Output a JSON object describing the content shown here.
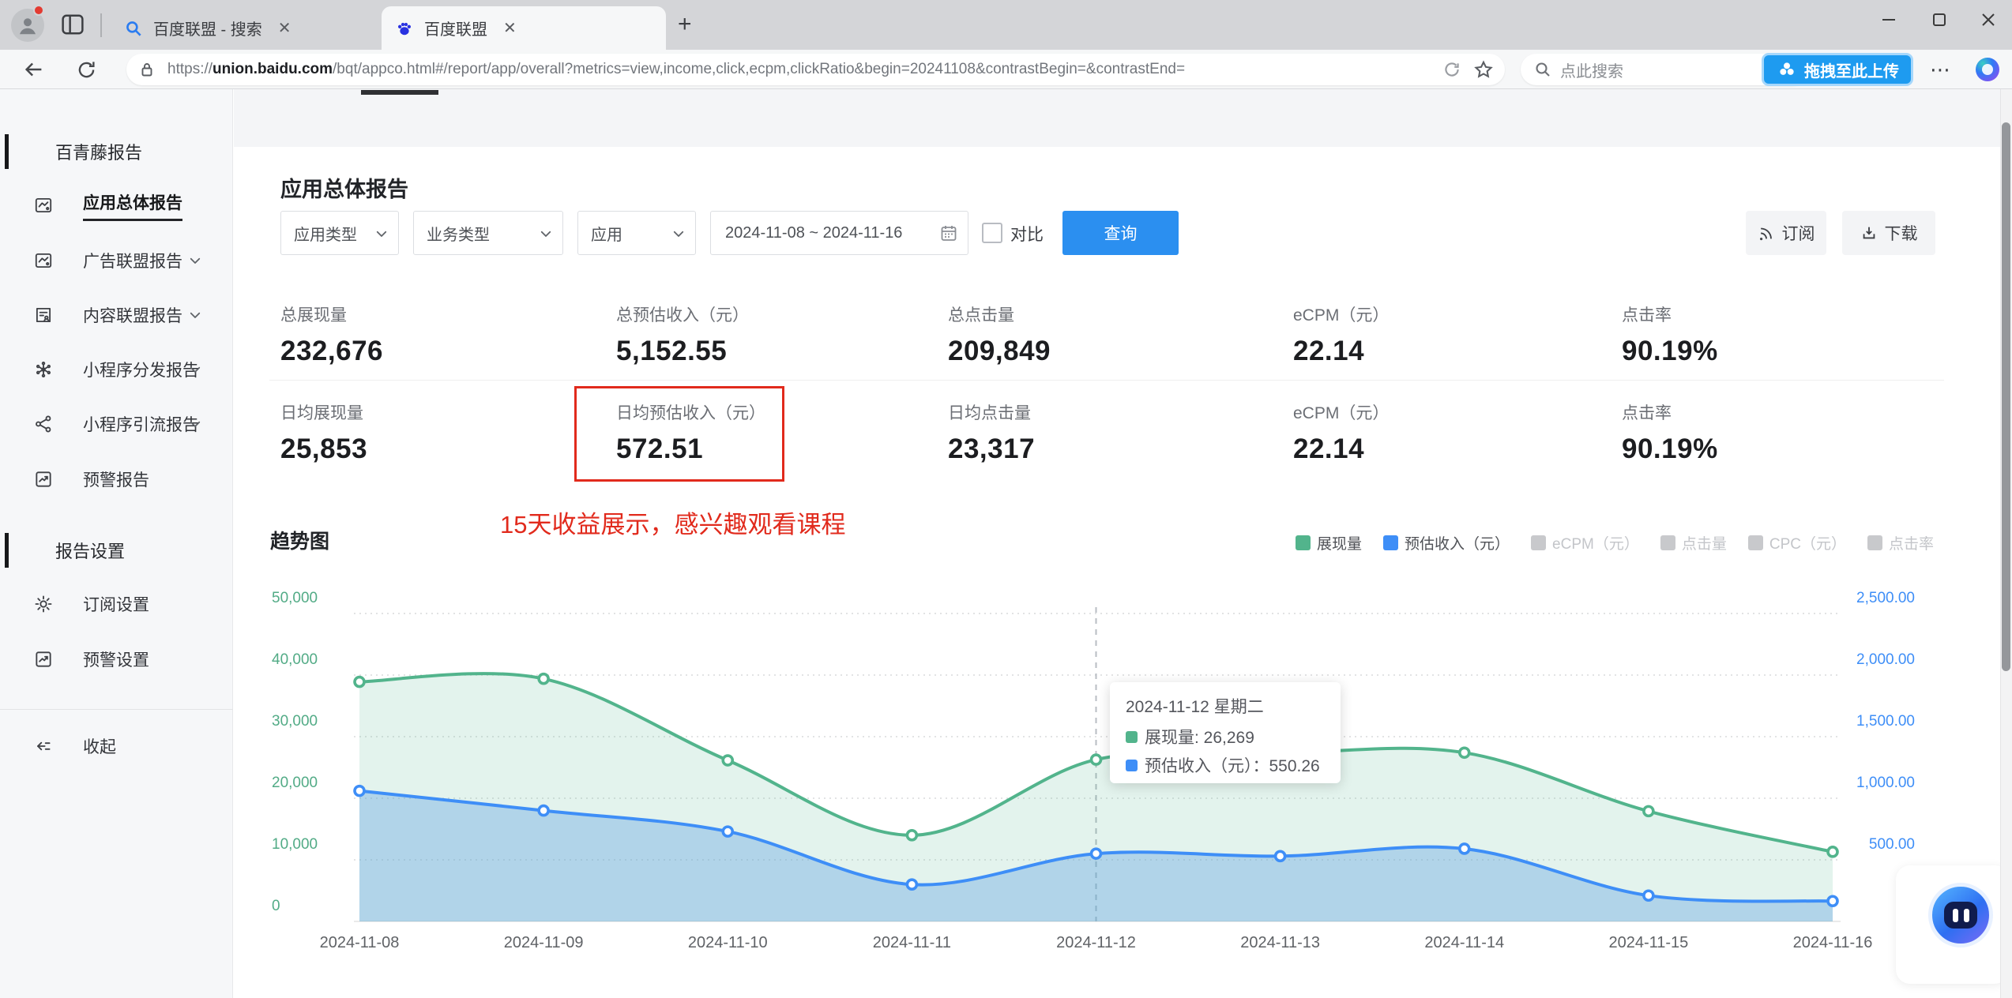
{
  "browser": {
    "tabs": [
      {
        "title": "百度联盟 - 搜索",
        "favicon": "search-favicon"
      },
      {
        "title": "百度联盟",
        "favicon": "baidu-paw-favicon"
      }
    ],
    "url": {
      "prefix": "https://",
      "host": "union.baidu.com",
      "path": "/bqt/appco.html#/report/app/overall?metrics=view,income,click,ecpm,clickRatio&begin=20241108&contrastBegin=&contrastEnd="
    },
    "search_placeholder": "点此搜索",
    "upload_button_label": "拖拽至此上传"
  },
  "sidebar": {
    "section1_title": "百青藤报告",
    "items": [
      {
        "label": "应用总体报告",
        "icon": "overall-report-icon",
        "active": true,
        "expandable": false
      },
      {
        "label": "广告联盟报告",
        "icon": "ad-report-icon",
        "active": false,
        "expandable": true
      },
      {
        "label": "内容联盟报告",
        "icon": "content-report-icon",
        "active": false,
        "expandable": true
      },
      {
        "label": "小程序分发报告",
        "icon": "distribution-icon",
        "active": false,
        "expandable": true
      },
      {
        "label": "小程序引流报告",
        "icon": "share-icon",
        "active": false,
        "expandable": true
      },
      {
        "label": "预警报告",
        "icon": "alert-report-icon",
        "active": false,
        "expandable": false
      }
    ],
    "section2_title": "报告设置",
    "settings_items": [
      {
        "label": "订阅设置",
        "icon": "gear-icon"
      },
      {
        "label": "预警设置",
        "icon": "alert-report-icon"
      }
    ],
    "collapse_label": "收起"
  },
  "page": {
    "title": "应用总体报告",
    "filters": {
      "selects": [
        {
          "label": "应用类型"
        },
        {
          "label": "业务类型"
        },
        {
          "label": "应用"
        }
      ],
      "date_range": "2024-11-08 ~ 2024-11-16",
      "compare_label": "对比",
      "compare_checked": false,
      "query_button": "查询"
    },
    "actions": {
      "subscribe": "订阅",
      "download": "下载"
    },
    "stats_row1": [
      {
        "label": "总展现量",
        "value": "232,676"
      },
      {
        "label": "总预估收入（元）",
        "value": "5,152.55"
      },
      {
        "label": "总点击量",
        "value": "209,849"
      },
      {
        "label": "eCPM（元）",
        "value": "22.14"
      },
      {
        "label": "点击率",
        "value": "90.19%"
      }
    ],
    "stats_row2": [
      {
        "label": "日均展现量",
        "value": "25,853"
      },
      {
        "label": "日均预估收入（元）",
        "value": "572.51",
        "highlighted": true
      },
      {
        "label": "日均点击量",
        "value": "23,317"
      },
      {
        "label": "eCPM（元）",
        "value": "22.14"
      },
      {
        "label": "点击率",
        "value": "90.19%"
      }
    ],
    "annotation": "15天收益展示，感兴趣观看课程",
    "chart_section_title": "趋势图"
  },
  "chart_data": {
    "type": "line",
    "title": "趋势图",
    "categories": [
      "2024-11-08",
      "2024-11-09",
      "2024-11-10",
      "2024-11-11",
      "2024-11-12",
      "2024-11-13",
      "2024-11-14",
      "2024-11-15",
      "2024-11-16"
    ],
    "series": [
      {
        "name": "展现量",
        "axis": "left",
        "color": "#52b48c",
        "fill": "rgba(82,180,140,0.16)",
        "values": [
          38900,
          39400,
          26150,
          14000,
          26269,
          27300,
          27400,
          17900,
          11300
        ]
      },
      {
        "name": "预估收入（元）",
        "axis": "right",
        "color": "#3e8ef7",
        "fill": "rgba(97,163,226,0.38)",
        "values": [
          1060,
          900,
          730,
          300,
          550.26,
          530,
          590,
          210,
          165
        ]
      }
    ],
    "left_axis": {
      "ticks": [
        "0",
        "10,000",
        "20,000",
        "30,000",
        "40,000",
        "50,000"
      ],
      "max": 50000,
      "color": "#52ab86"
    },
    "right_axis": {
      "ticks": [
        "0",
        "500.00",
        "1,000.00",
        "1,500.00",
        "2,000.00",
        "2,500.00"
      ],
      "max": 2500,
      "color": "#3e8ef7"
    },
    "legend": [
      {
        "label": "展现量",
        "color": "#52b48c",
        "active": true
      },
      {
        "label": "预估收入（元）",
        "color": "#3e8ef7",
        "active": true
      },
      {
        "label": "eCPM（元）",
        "color": "#c8c9cc",
        "active": false
      },
      {
        "label": "点击量",
        "color": "#c8c9cc",
        "active": false
      },
      {
        "label": "CPC（元）",
        "color": "#c8c9cc",
        "active": false
      },
      {
        "label": "点击率",
        "color": "#c8c9cc",
        "active": false
      }
    ],
    "grid": "dotted-horizontal",
    "hover_index": 4,
    "tooltip": {
      "title": "2024-11-12 星期二",
      "rows": [
        {
          "color": "#52b48c",
          "text": "展现量: 26,269"
        },
        {
          "color": "#3e8ef7",
          "text": "预估收入（元）：550.26"
        }
      ]
    }
  }
}
